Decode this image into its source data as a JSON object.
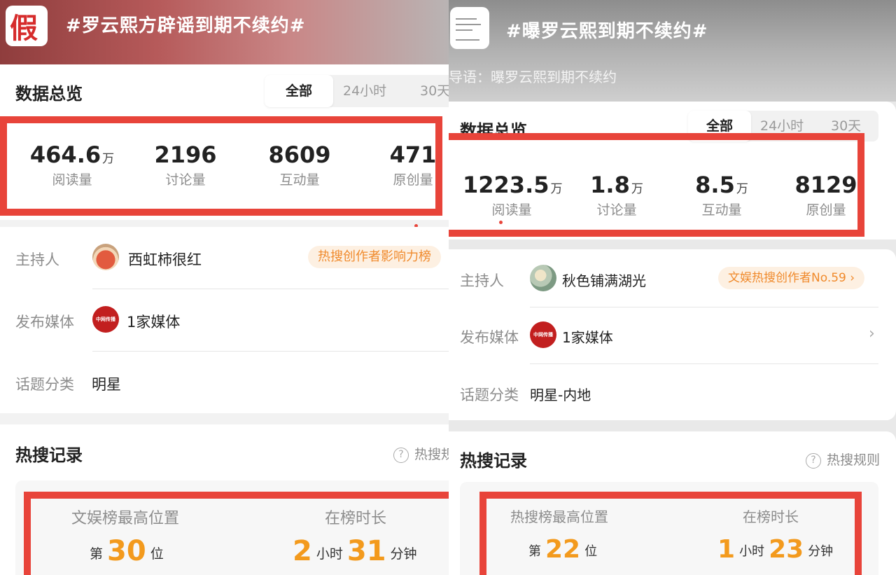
{
  "left": {
    "thumb_text": "假",
    "topic_title": "#罗云熙方辟谣到期不续约#",
    "overview_title": "数据总览",
    "tabs": [
      "全部",
      "24小时",
      "30天"
    ],
    "stats": [
      {
        "value": "464.6",
        "unit": "万",
        "label": "阅读量"
      },
      {
        "value": "2196",
        "unit": "",
        "label": "讨论量"
      },
      {
        "value": "8609",
        "unit": "",
        "label": "互动量"
      },
      {
        "value": "471",
        "unit": "",
        "label": "原创量"
      }
    ],
    "host_label": "主持人",
    "host_name": "西虹柿很红",
    "host_badge": "热搜创作者影响力榜",
    "media_label": "发布媒体",
    "media_avatar_text": "中网传播",
    "media_value": "1家媒体",
    "category_label": "话题分类",
    "category_value": "明星",
    "record_title": "热搜记录",
    "help_text": "热搜规",
    "record": {
      "rank_label": "文娱榜最高位置",
      "rank_prefix": "第",
      "rank_value": "30",
      "rank_suffix": "位",
      "duration_label": "在榜时长",
      "hours": "2",
      "hours_unit": "小时",
      "minutes": "31",
      "minutes_unit": "分钟"
    }
  },
  "right": {
    "topic_title": "#曝罗云熙到期不续约#",
    "lead_text": "导语：曝罗云熙到期不续约",
    "overview_title": "数据总览",
    "tabs": [
      "全部",
      "24小时",
      "30天"
    ],
    "stats": [
      {
        "value": "1223.5",
        "unit": "万",
        "label": "阅读量"
      },
      {
        "value": "1.8",
        "unit": "万",
        "label": "讨论量"
      },
      {
        "value": "8.5",
        "unit": "万",
        "label": "互动量"
      },
      {
        "value": "8129",
        "unit": "",
        "label": "原创量"
      }
    ],
    "host_label": "主持人",
    "host_name": "秋色铺满湖光",
    "host_badge": "文娱热搜创作者No.59 ›",
    "media_label": "发布媒体",
    "media_avatar_text": "中网传播",
    "media_value": "1家媒体",
    "category_label": "话题分类",
    "category_value": "明星-内地",
    "record_title": "热搜记录",
    "help_text": "热搜规则",
    "record": {
      "rank_label": "热搜榜最高位置",
      "rank_prefix": "第",
      "rank_value": "22",
      "rank_suffix": "位",
      "duration_label": "在榜时长",
      "hours": "1",
      "hours_unit": "小时",
      "minutes": "23",
      "minutes_unit": "分钟"
    }
  },
  "colors": {
    "accent_orange": "#f39a1d",
    "highlight_red": "#e8443a",
    "badge_bg": "#fdf0e2"
  },
  "icons": [
    "help-icon",
    "chevron-right-icon"
  ]
}
